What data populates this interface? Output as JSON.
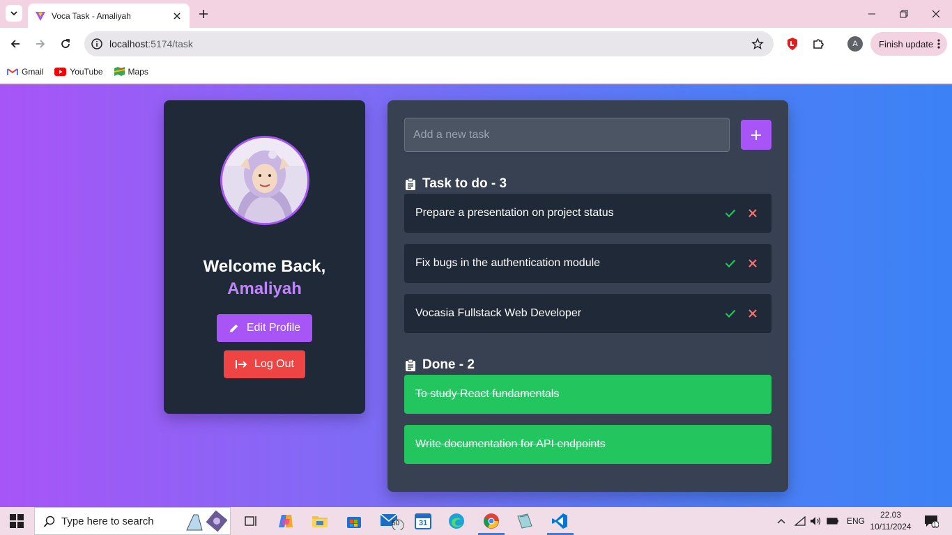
{
  "browser": {
    "tab_title": "Voca Task - Amaliyah",
    "url_host": "localhost",
    "url_path": ":5174/task",
    "finish_update_label": "Finish update",
    "profile_initial": "A",
    "bookmarks": [
      "Gmail",
      "YouTube",
      "Maps"
    ]
  },
  "profile": {
    "welcome": "Welcome Back,",
    "name": "Amaliyah",
    "edit_label": "Edit Profile",
    "logout_label": "Log Out"
  },
  "tasks": {
    "input_placeholder": "Add a new task",
    "todo_title": "Task to do - 3",
    "todo": [
      "Prepare a presentation on project status",
      "Fix bugs in the authentication module",
      "Vocasia Fullstack Web Developer"
    ],
    "done_title": "Done - 2",
    "done": [
      "To study React fundamentals",
      "Write documentation for API endpoints"
    ]
  },
  "taskbar": {
    "search_placeholder": "Type here to search",
    "mail_badge": "50",
    "calendar_day": "31",
    "language": "ENG",
    "time": "22.03",
    "date": "10/11/2024",
    "notification_count": "1"
  },
  "colors": {
    "accent": "#a855f7",
    "danger": "#ef4444",
    "done": "#22c55e",
    "card": "#1f2937",
    "panel": "#374151"
  }
}
